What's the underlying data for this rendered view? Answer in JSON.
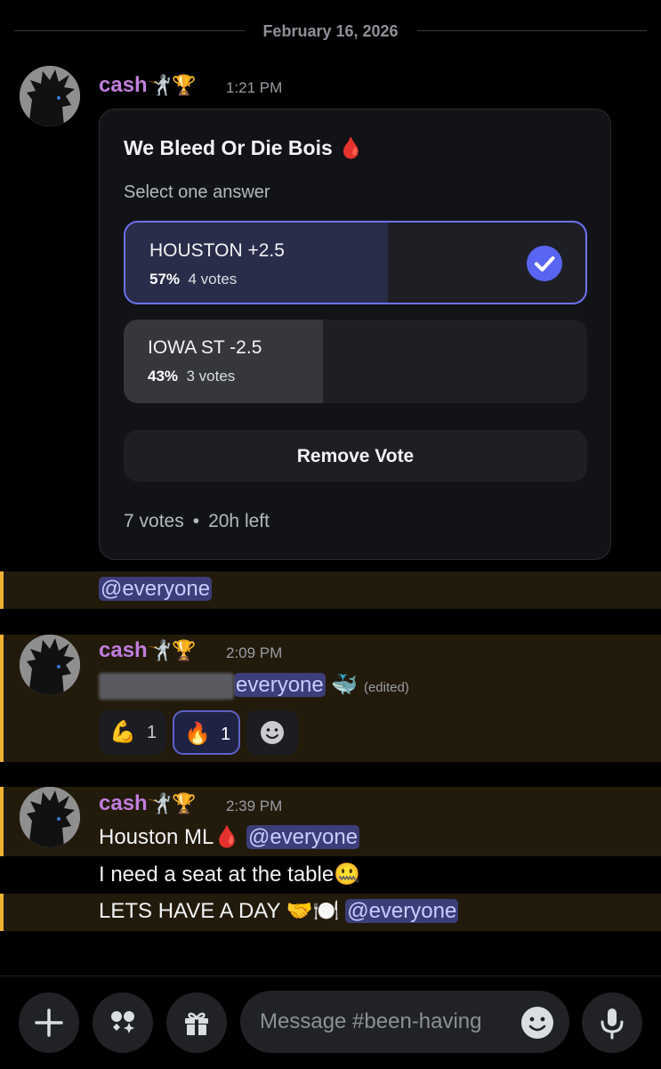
{
  "date_divider": "February 16, 2026",
  "colors": {
    "mention_bg": "#3b3e78",
    "highlight_bar": "#f0b232",
    "accent": "#5865f2",
    "username": "#c07edc"
  },
  "messages": [
    {
      "username": "cash",
      "user_emojis": "🤺🏆",
      "time": "1:21 PM"
    },
    {
      "username": "cash",
      "user_emojis": "🤺🏆",
      "time": "2:09 PM"
    },
    {
      "username": "cash",
      "user_emojis": "🤺🏆",
      "time": "2:39 PM"
    }
  ],
  "poll": {
    "question": "We Bleed Or Die Bois",
    "question_emoji": "🩸",
    "instruction": "Select one answer",
    "options": [
      {
        "label": "HOUSTON +2.5",
        "percent": "57%",
        "votes": "4 votes",
        "fill_fraction": 0.57,
        "selected": true
      },
      {
        "label": "IOWA ST -2.5",
        "percent": "43%",
        "votes": "3 votes",
        "fill_fraction": 0.43,
        "selected": false
      }
    ],
    "remove_label": "Remove Vote",
    "total_votes": "7 votes",
    "separator": "•",
    "time_left": "20h left"
  },
  "mention_line": "@everyone",
  "msg2": {
    "mention_text": "everyone",
    "emoji": "🐳",
    "edited": "(edited)",
    "reactions": [
      {
        "emoji": "💪",
        "count": "1",
        "active": false
      },
      {
        "emoji": "🔥",
        "count": "1",
        "active": true
      }
    ]
  },
  "msg3": {
    "line1_text": "Houston ML",
    "line1_emoji": "🩸",
    "line1_mention": "@everyone",
    "line2_text": "I need a seat at the table",
    "line2_emoji": "🤐",
    "line3_text": "LETS HAVE A DAY",
    "line3_emoji": "🤝🍽️",
    "line3_mention": "@everyone"
  },
  "composer": {
    "placeholder": "Message #been-having"
  }
}
